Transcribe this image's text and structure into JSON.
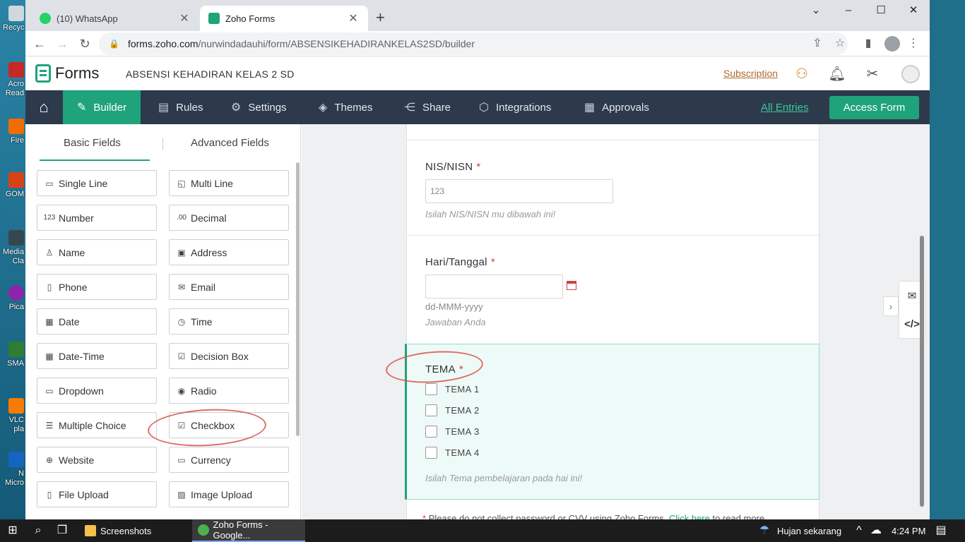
{
  "desktop": {
    "icons": [
      "Recyc",
      "Acro Read",
      "Fire",
      "GOM",
      "Media Cla",
      "Pica",
      "SMA",
      "VLC pla",
      "N Micro"
    ]
  },
  "browser": {
    "tabs": [
      {
        "title": "(10) WhatsApp",
        "badge": "10"
      },
      {
        "title": "Zoho Forms"
      }
    ],
    "url_host": "forms.zoho.com",
    "url_path": "/nurwindadauhi/form/ABSENSIKEHADIRANKELAS2SD/builder"
  },
  "zoho": {
    "brand": "Forms",
    "form_name": "ABSENSI KEHADIRAN KELAS 2 SD",
    "subscription": "Subscription",
    "nav": {
      "builder": "Builder",
      "rules": "Rules",
      "settings": "Settings",
      "themes": "Themes",
      "share": "Share",
      "integrations": "Integrations",
      "approvals": "Approvals",
      "all_entries": "All Entries",
      "access_form": "Access Form"
    }
  },
  "fields_panel": {
    "tab_basic": "Basic Fields",
    "tab_advanced": "Advanced Fields",
    "fields": [
      {
        "label": "Single Line",
        "icon": "single-line-icon"
      },
      {
        "label": "Multi Line",
        "icon": "multi-line-icon"
      },
      {
        "label": "Number",
        "icon": "number-icon",
        "glyph": "123"
      },
      {
        "label": "Decimal",
        "icon": "decimal-icon",
        "glyph": ".00"
      },
      {
        "label": "Name",
        "icon": "person-icon"
      },
      {
        "label": "Address",
        "icon": "address-icon"
      },
      {
        "label": "Phone",
        "icon": "phone-icon"
      },
      {
        "label": "Email",
        "icon": "email-icon"
      },
      {
        "label": "Date",
        "icon": "calendar-icon"
      },
      {
        "label": "Time",
        "icon": "clock-icon"
      },
      {
        "label": "Date-Time",
        "icon": "datetime-icon"
      },
      {
        "label": "Decision Box",
        "icon": "checkbox-checked-icon"
      },
      {
        "label": "Dropdown",
        "icon": "dropdown-icon"
      },
      {
        "label": "Radio",
        "icon": "radio-icon"
      },
      {
        "label": "Multiple Choice",
        "icon": "multiple-choice-icon"
      },
      {
        "label": "Checkbox",
        "icon": "checklist-icon"
      },
      {
        "label": "Website",
        "icon": "globe-icon"
      },
      {
        "label": "Currency",
        "icon": "currency-icon"
      },
      {
        "label": "File Upload",
        "icon": "file-upload-icon"
      },
      {
        "label": "Image Upload",
        "icon": "image-upload-icon"
      }
    ]
  },
  "form": {
    "nis": {
      "label": "NIS/NISN",
      "required_mark": "*",
      "placeholder": "123",
      "help": "Isilah NIS/NISN mu dibawah ini!"
    },
    "tanggal": {
      "label": "Hari/Tanggal",
      "required_mark": "*",
      "format_hint": "dd-MMM-yyyy",
      "help": "Jawaban Anda"
    },
    "tema": {
      "label": "TEMA",
      "required_mark": "*",
      "options": [
        "TEMA 1",
        "TEMA 2",
        "TEMA 3",
        "TEMA 4"
      ],
      "help": "Isilah Tema pembelajaran pada hai ini!"
    },
    "disclaimer": {
      "star": "*",
      "text": "Please do not collect password or CVV using Zoho Forms.",
      "link": "Click here",
      "tail": "to read more"
    }
  },
  "taskbar": {
    "apps": [
      {
        "label": "Screenshots"
      },
      {
        "label": "Zoho Forms - Google..."
      }
    ],
    "weather": "Hujan sekarang",
    "time": "4:24 PM"
  },
  "colors": {
    "accent": "#1fa37b",
    "nav_bg": "#2d3a4b",
    "required": "#e03c31",
    "annotation": "#d9534f"
  }
}
